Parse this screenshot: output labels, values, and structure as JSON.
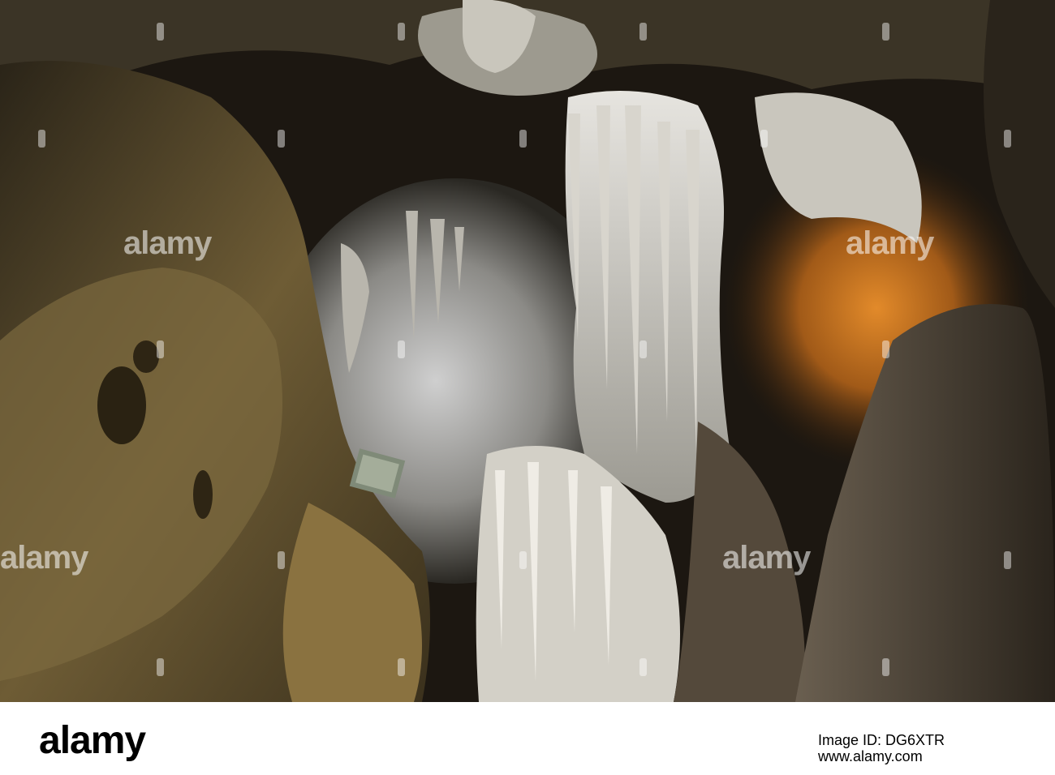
{
  "photo": {
    "watermark_text": "alamy",
    "colors": {
      "dark_rock": "#1c1711",
      "ochre_rock": "#6b5a35",
      "lit_limestone": "#d9d6cc",
      "orange_light": "#c8781f",
      "shadow": "#0d0b08"
    }
  },
  "footer": {
    "logo": "alamy",
    "image_id": "Image ID: DG6XTR",
    "url": "www.alamy.com"
  }
}
